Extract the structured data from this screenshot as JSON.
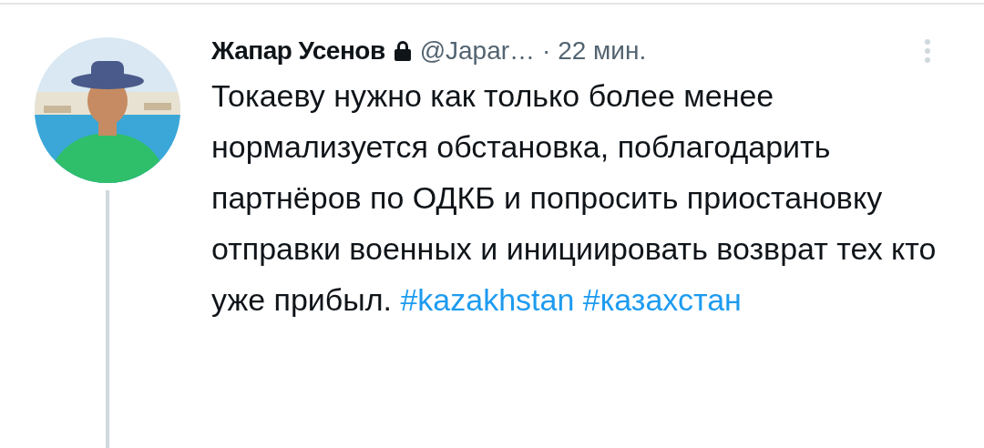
{
  "tweet": {
    "author": {
      "name": "Жапар Усенов",
      "protected": true,
      "handle": "@Japar…",
      "time": "· 22 мин."
    },
    "text": "Токаеву нужно как только более менее нормализуется обстановка, поблагодарить партнёров по ОДКБ и попросить приостановку отправки военных и инициировать возврат тех кто уже прибыл.",
    "hashtags": [
      "#kazakhstan",
      "#казахстан"
    ],
    "thread_continues": true
  }
}
